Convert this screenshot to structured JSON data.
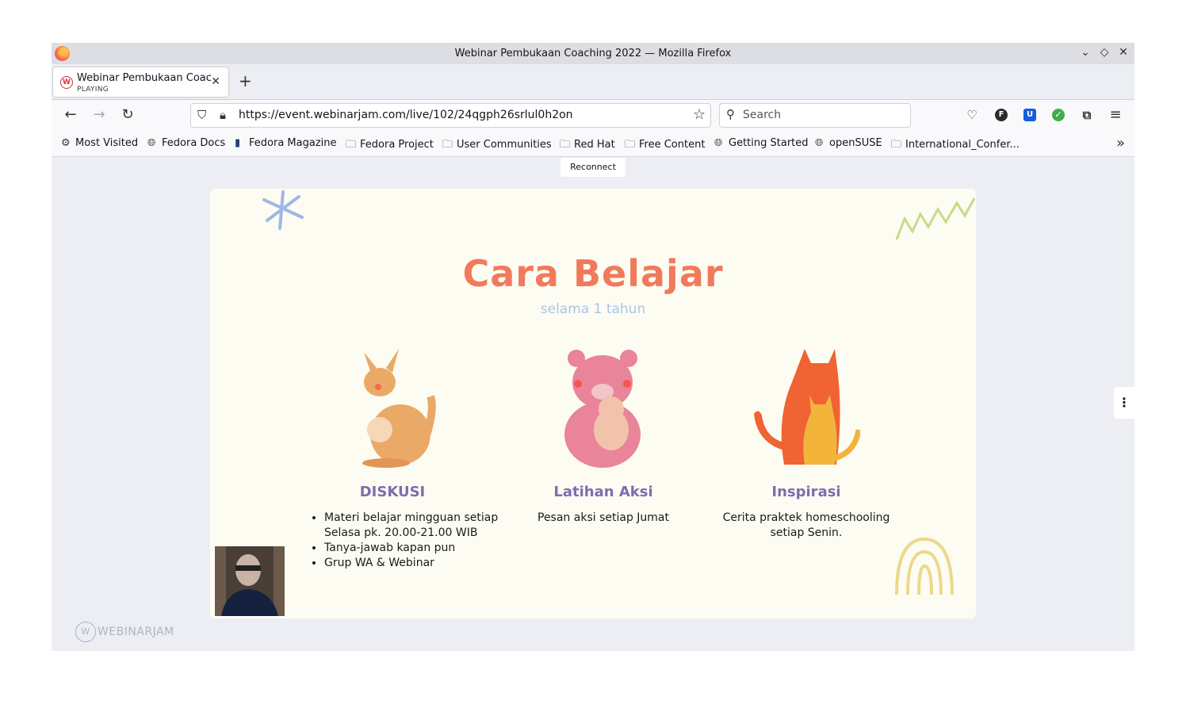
{
  "window": {
    "title": "Webinar Pembukaan Coaching 2022 — Mozilla Firefox",
    "controls": [
      "chevron-down-icon",
      "restore-icon",
      "close-icon"
    ]
  },
  "tab": {
    "title": "Webinar Pembukaan Coac",
    "status": "PLAYING",
    "favicon_letter": "W"
  },
  "navbar": {
    "url": "https://event.webinarjam.com/live/102/24qgph26srlul0h2on",
    "search_placeholder": "Search",
    "extensions": [
      {
        "name": "pocket-icon",
        "color": "#333333"
      },
      {
        "name": "extension-f-icon",
        "label": "F",
        "color": "#2b2b2b"
      },
      {
        "name": "bitwarden-icon",
        "label": "U",
        "color": "#175ddc"
      },
      {
        "name": "shield-check-icon",
        "color": "#3fae49"
      },
      {
        "name": "tab-icon",
        "color": "#333333"
      }
    ]
  },
  "bookmarks": [
    {
      "label": "Most Visited",
      "icon": "gear-icon"
    },
    {
      "label": "Fedora Docs",
      "icon": "globe-icon"
    },
    {
      "label": "Fedora Magazine",
      "icon": "fm-icon"
    },
    {
      "label": "Fedora Project",
      "icon": "folder-icon"
    },
    {
      "label": "User Communities",
      "icon": "folder-icon"
    },
    {
      "label": "Red Hat",
      "icon": "folder-icon"
    },
    {
      "label": "Free Content",
      "icon": "folder-icon"
    },
    {
      "label": "Getting Started",
      "icon": "globe-icon"
    },
    {
      "label": "openSUSE",
      "icon": "globe-icon"
    },
    {
      "label": "International_Confer...",
      "icon": "folder-icon"
    }
  ],
  "webinar": {
    "reconnect_label": "Reconnect",
    "brand": "WEBINARJAM",
    "slide": {
      "title": "Cara Belajar",
      "subtitle": "selama 1 tahun",
      "columns": [
        {
          "title": "DISKUSI",
          "bullets": [
            "Materi belajar mingguan setiap Selasa pk. 20.00-21.00 WIB",
            "Tanya-jawab kapan pun",
            "Grup WA & Webinar"
          ]
        },
        {
          "title": "Latihan Aksi",
          "text": "Pesan aksi setiap Jumat"
        },
        {
          "title": "Inspirasi",
          "text": "Cerita praktek homeschooling setiap Senin."
        }
      ]
    }
  }
}
